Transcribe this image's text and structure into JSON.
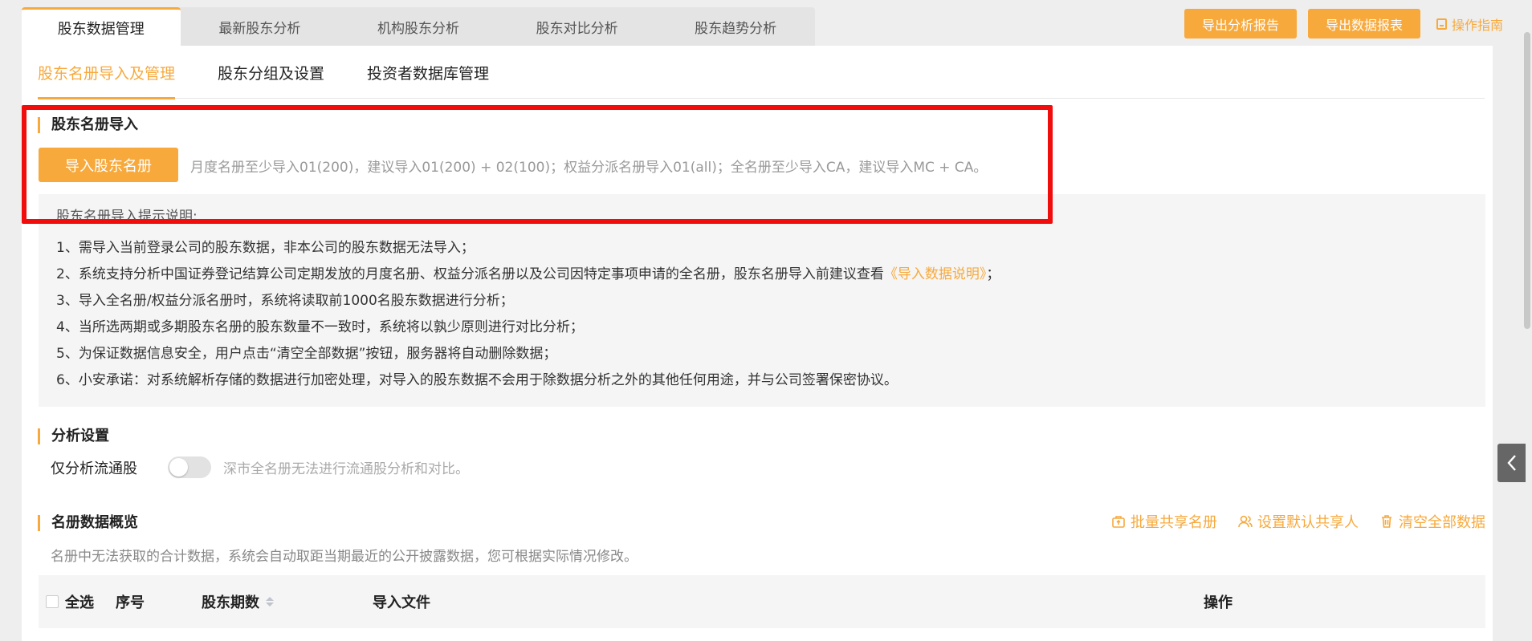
{
  "top_tabs": [
    "股东数据管理",
    "最新股东分析",
    "机构股东分析",
    "股东对比分析",
    "股东趋势分析"
  ],
  "top_actions": {
    "export_report": "导出分析报告",
    "export_data": "导出数据报表",
    "guide": "操作指南"
  },
  "sub_tabs": [
    "股东名册导入及管理",
    "股东分组及设置",
    "投资者数据库管理"
  ],
  "import_section": {
    "title": "股东名册导入",
    "button": "导入股东名册",
    "hint": "月度名册至少导入01(200)，建议导入01(200) + 02(100)；权益分派名册导入01(all)；全名册至少导入CA，建议导入MC + CA。"
  },
  "notes": {
    "title": "股东名册导入提示说明:",
    "line1": "1、需导入当前登录公司的股东数据，非本公司的股东数据无法导入；",
    "line2_pre": "2、系统支持分析中国证券登记结算公司定期发放的月度名册、权益分派名册以及公司因特定事项申请的全名册，股东名册导入前建议查看",
    "line2_link": "《导入数据说明》",
    "line2_post": "；",
    "line3": "3、导入全名册/权益分派名册时，系统将读取前1000名股东数据进行分析；",
    "line4": "4、当所选两期或多期股东名册的股东数量不一致时，系统将以孰少原则进行对比分析；",
    "line5": "5、为保证数据信息安全，用户点击“清空全部数据”按钮，服务器将自动删除数据；",
    "line6": "6、小安承诺：对系统解析存储的数据进行加密处理，对导入的股东数据不会用于除数据分析之外的其他任何用途，并与公司签署保密协议。"
  },
  "analysis_settings": {
    "title": "分析设置",
    "label": "仅分析流通股",
    "toggle_on": false,
    "hint": "深市全名册无法进行流通股分析和对比。"
  },
  "overview": {
    "title": "名册数据概览",
    "actions": [
      "批量共享名册",
      "设置默认共享人",
      "清空全部数据"
    ],
    "hint": "名册中无法获取的合计数据，系统会自动取距当期最近的公开披露数据，您可根据实际情况修改。"
  },
  "table": {
    "headers": {
      "select_all": "全选",
      "index": "序号",
      "periods": "股东期数",
      "file": "导入文件",
      "actions": "操作"
    }
  },
  "colors": {
    "accent": "#f7a93c",
    "highlight": "#f20d0d"
  }
}
